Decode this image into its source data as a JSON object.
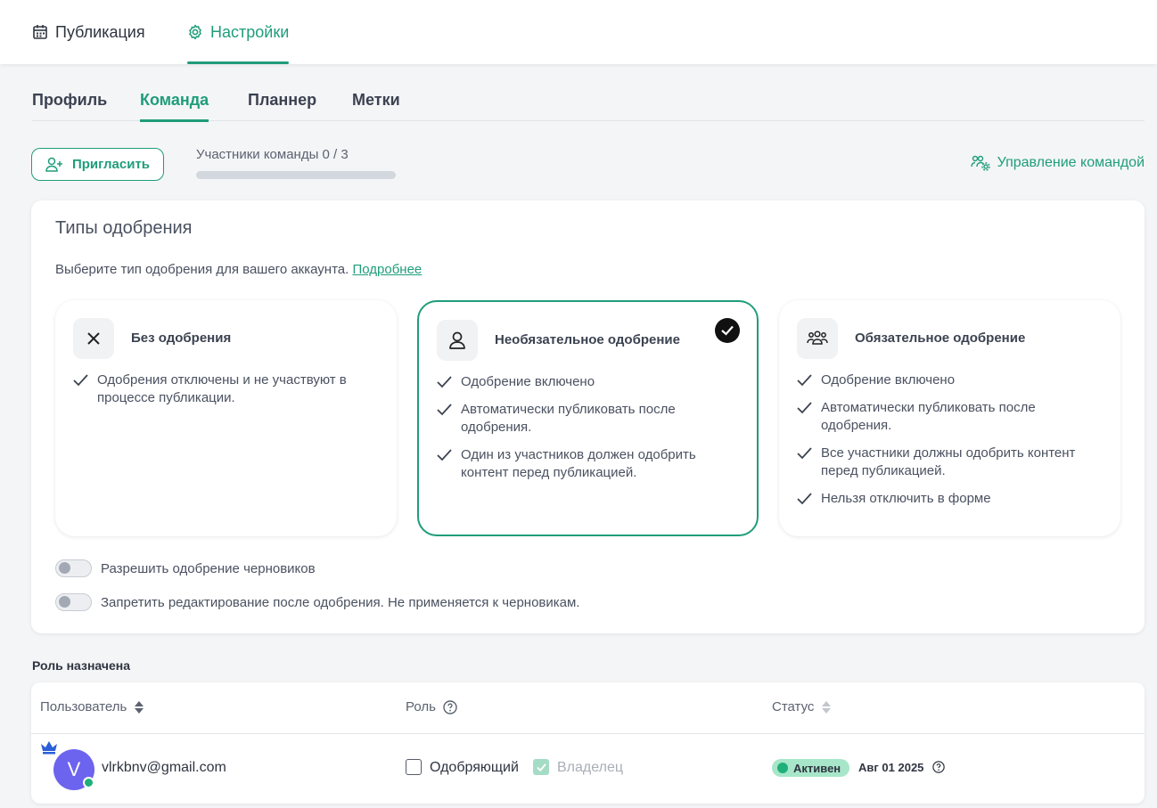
{
  "header": {
    "tabs": [
      {
        "label": "Публикация",
        "icon": "calendar-icon"
      },
      {
        "label": "Настройки",
        "icon": "gear-icon",
        "active": true
      }
    ]
  },
  "subtabs": [
    {
      "label": "Профиль"
    },
    {
      "label": "Команда",
      "active": true
    },
    {
      "label": "Планнер"
    },
    {
      "label": "Метки"
    }
  ],
  "team": {
    "invite_label": "Пригласить",
    "members_label": "Участники команды 0 / 3",
    "members_progress": 0,
    "manage_label": "Управление командой"
  },
  "approvals": {
    "title": "Типы одобрения",
    "description": "Выберите тип одобрения для вашего аккаунта.",
    "more_link": "Подробнее",
    "options": [
      {
        "title": "Без одобрения",
        "icon": "close-icon",
        "selected": false,
        "features": [
          "Одобрения отключены и не участвуют в процессе публикации."
        ]
      },
      {
        "title": "Необязательное одобрение",
        "icon": "user-icon",
        "selected": true,
        "features": [
          "Одобрение включено",
          "Автоматически публиковать после одобрения.",
          "Один из участников должен одобрить контент перед публикацией."
        ]
      },
      {
        "title": "Обязательное одобрение",
        "icon": "users-group-icon",
        "selected": false,
        "features": [
          "Одобрение включено",
          "Автоматически публиковать после одобрения.",
          "Все участники должны одобрить контент перед публикацией.",
          "Нельзя отключить в форме"
        ]
      }
    ],
    "toggles": [
      {
        "label": "Разрешить одобрение черновиков",
        "on": false
      },
      {
        "label": "Запретить редактирование после одобрения. Не применяется к черновикам.",
        "on": false
      }
    ]
  },
  "roles": {
    "title": "Роль назначена",
    "columns": {
      "user": "Пользователь",
      "role": "Роль",
      "status": "Статус"
    },
    "rows": [
      {
        "avatar_letter": "V",
        "avatar_color": "#6c63ef",
        "email": "vlrkbnv@gmail.com",
        "approver_label": "Одобряющий",
        "approver_checked": false,
        "owner_label": "Владелец",
        "owner_checked": true,
        "status": "Активен",
        "date": "Авг 01 2025"
      }
    ]
  },
  "colors": {
    "accent": "#1f9d7a",
    "status_bg": "#a8e6c9",
    "avatar": "#6c63ef"
  }
}
